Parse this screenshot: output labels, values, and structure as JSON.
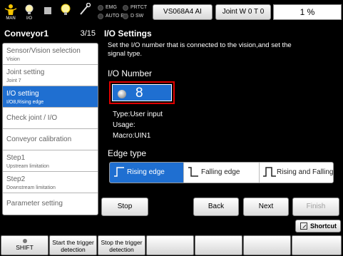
{
  "status_bar": {
    "icons": [
      {
        "name": "man-mode",
        "caption": "MAN"
      },
      {
        "name": "io-monitor",
        "caption": "I/O"
      },
      {
        "name": "stop-indicator",
        "caption": ""
      },
      {
        "name": "lamp",
        "caption": ""
      },
      {
        "name": "tool",
        "caption": ""
      }
    ],
    "lamps": [
      {
        "label": "EMG",
        "state": "off"
      },
      {
        "label": "PRTCT",
        "state": "off"
      },
      {
        "label": "AUTO EN",
        "state": "off"
      },
      {
        "label": "D SW",
        "state": "off"
      }
    ],
    "robot_button": "VS068A4 AI",
    "joint_button": "Joint  W 0 T 0",
    "speed": "1 %"
  },
  "left_panel": {
    "title": "Conveyor1",
    "page": "3/15",
    "items": [
      {
        "label": "Sensor/Vision selection",
        "sub": "Vision",
        "selected": false
      },
      {
        "label": "Joint setting",
        "sub": "Joint 7",
        "selected": false
      },
      {
        "label": "I/O setting",
        "sub": "I/O8,Rising edge",
        "selected": true
      },
      {
        "label": "Check joint / I/O",
        "sub": "",
        "selected": false
      },
      {
        "label": "Conveyor calibration",
        "sub": "",
        "selected": false
      },
      {
        "label": "Step1",
        "sub": "Upstream limitation",
        "selected": false
      },
      {
        "label": "Step2",
        "sub": "Downstream limitation",
        "selected": false
      },
      {
        "label": "Parameter setting",
        "sub": "",
        "selected": false
      }
    ]
  },
  "main": {
    "title": "I/O Settings",
    "description_line1": "Set the I/O number that is connected to the vision,and set the",
    "description_line2": "signal type.",
    "io_number_label": "I/O Number",
    "io_number_value": "8",
    "type": "Type:User input",
    "usage": "Usage:",
    "macro": "Macro:UIN1",
    "edge_type_label": "Edge type",
    "edge_options": [
      {
        "label": "Rising edge",
        "selected": true
      },
      {
        "label": "Falling edge",
        "selected": false
      },
      {
        "label": "Rising and Falling",
        "selected": false
      }
    ],
    "buttons": {
      "stop": "Stop",
      "back": "Back",
      "next": "Next",
      "finish": "Finish"
    },
    "shortcut": "Shortcut"
  },
  "function_keys": [
    {
      "label": "SHIFT",
      "label2": ""
    },
    {
      "label": "Start the trigger",
      "label2": "detection"
    },
    {
      "label": "Stop the trigger",
      "label2": "detection"
    },
    {
      "label": "",
      "label2": ""
    },
    {
      "label": "",
      "label2": ""
    },
    {
      "label": "",
      "label2": ""
    },
    {
      "label": "",
      "label2": ""
    }
  ],
  "colors": {
    "accent": "#1f6fd1",
    "highlight_border": "#e00000",
    "background": "#000000"
  }
}
